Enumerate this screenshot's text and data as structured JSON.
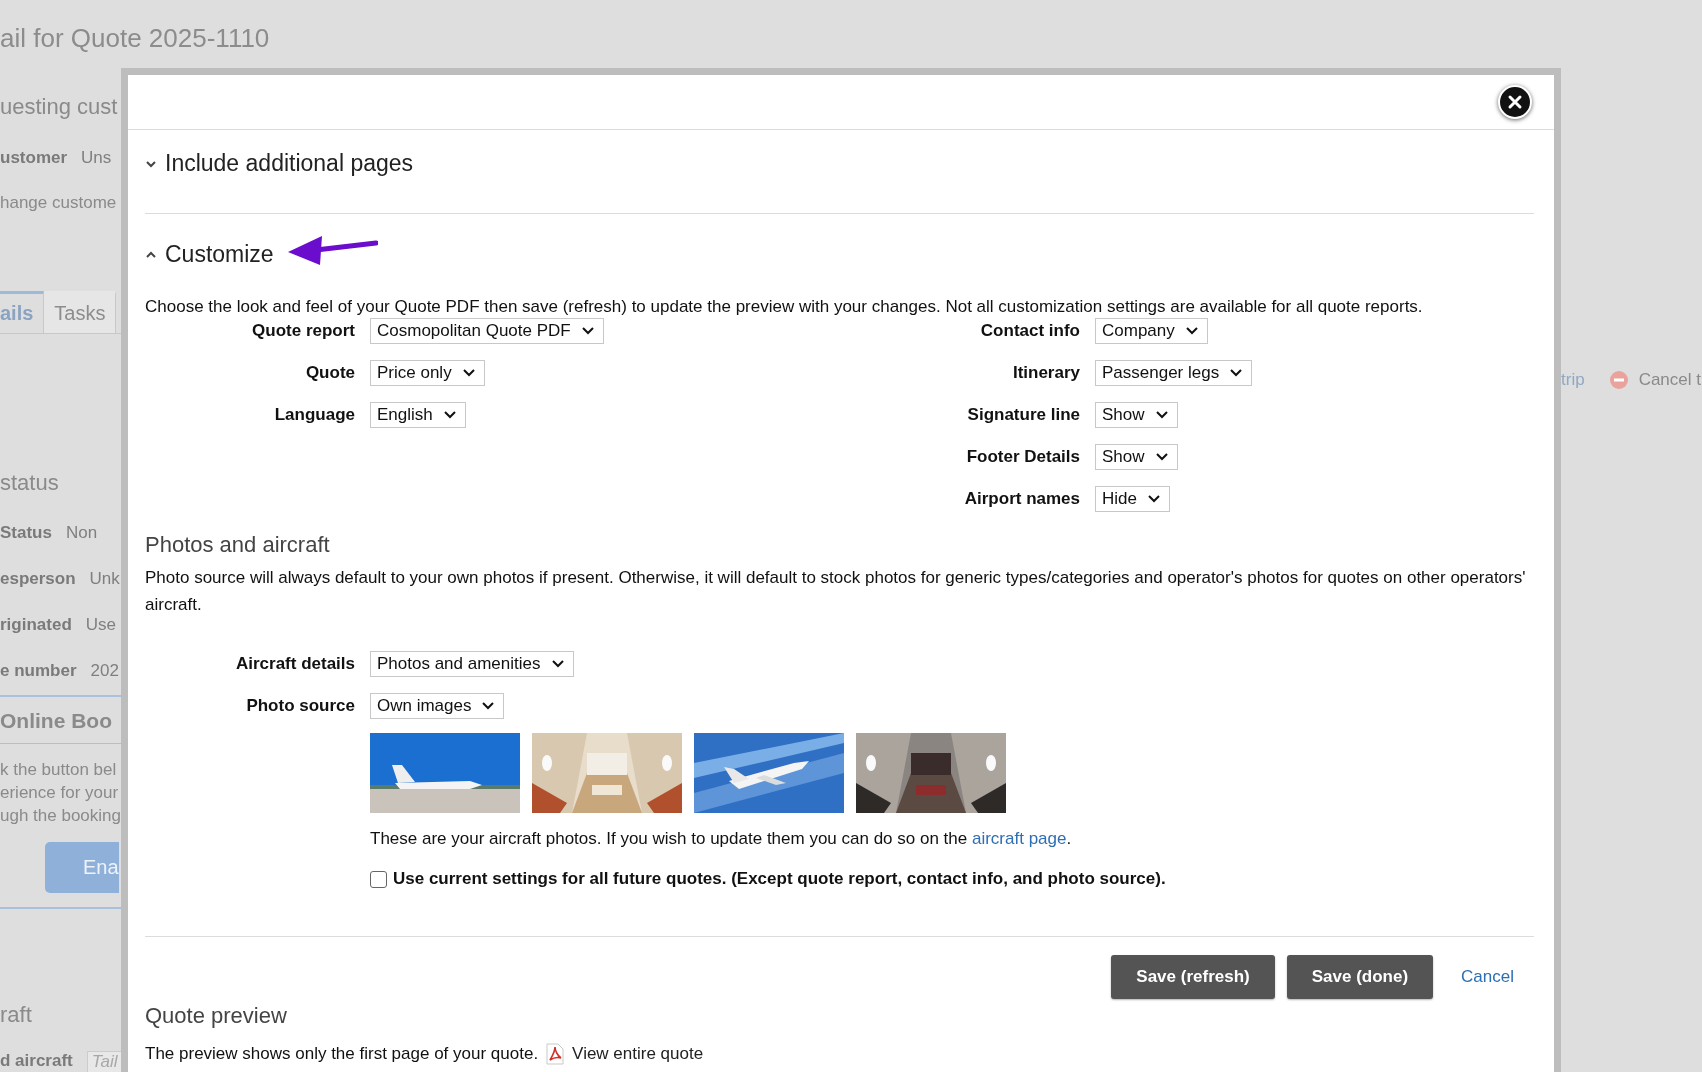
{
  "background": {
    "page_title": "ail for Quote 2025-1110",
    "heading": "uesting cust",
    "customer_label": "ustomer",
    "customer_value": "Uns",
    "change_customer": "hange custome",
    "tabs": [
      {
        "label": "ails",
        "selected": true
      },
      {
        "label": "Tasks",
        "selected": false
      }
    ],
    "status_heading": "status",
    "fields": [
      {
        "label": "Status",
        "value": "Non"
      },
      {
        "label": "esperson",
        "value": "Unk"
      },
      {
        "label": "riginated",
        "value": "Use"
      },
      {
        "label": "e number",
        "value": "202"
      }
    ],
    "online_booking": {
      "heading": "Online Boo",
      "lines": [
        "k the button bel",
        "erience for your",
        "ugh the booking"
      ],
      "button": "Ena"
    },
    "aircraft_heading": "raft",
    "aircraft_label": "d aircraft",
    "aircraft_placeholder": "Tail",
    "right_actions": [
      {
        "label": "trip",
        "kind": "text"
      },
      {
        "label": "Cancel t",
        "kind": "cancel"
      }
    ]
  },
  "dialog": {
    "sections": [
      {
        "title": "Include additional pages",
        "expanded": false
      },
      {
        "title": "Customize",
        "expanded": true
      }
    ],
    "customize": {
      "description": "Choose the look and feel of your Quote PDF then save (refresh) to update the preview with your changes. Not all customization settings are available for all quote reports.",
      "left_fields": [
        {
          "label": "Quote report",
          "value": "Cosmopolitan Quote PDF"
        },
        {
          "label": "Quote",
          "value": "Price only"
        },
        {
          "label": "Language",
          "value": "English"
        }
      ],
      "right_fields": [
        {
          "label": "Contact info",
          "value": "Company"
        },
        {
          "label": "Itinerary",
          "value": "Passenger legs"
        },
        {
          "label": "Signature line",
          "value": "Show"
        },
        {
          "label": "Footer Details",
          "value": "Show"
        },
        {
          "label": "Airport names",
          "value": "Hide"
        }
      ],
      "photos": {
        "heading": "Photos and aircraft",
        "description": "Photo source will always default to your own photos if present. Otherwise, it will default to stock photos for generic types/categories and operator's photos for quotes on other operators' aircraft.",
        "fields": [
          {
            "label": "Aircraft details",
            "value": "Photos and amenities"
          },
          {
            "label": "Photo source",
            "value": "Own images"
          }
        ],
        "note_before": "These are your aircraft photos. If you wish to update them you can do so on the",
        "note_link": "aircraft page",
        "note_after": "."
      },
      "remember": {
        "label": "Use current settings for all future quotes. (Except quote report, contact info, and photo source).",
        "checked": false
      },
      "buttons": [
        {
          "label": "Save (refresh)",
          "kind": "primary"
        },
        {
          "label": "Save (done)",
          "kind": "primary"
        },
        {
          "label": "Cancel",
          "kind": "link"
        }
      ]
    },
    "preview": {
      "heading": "Quote preview",
      "text": "The preview shows only the first page of your quote.",
      "link": "View entire quote"
    }
  }
}
